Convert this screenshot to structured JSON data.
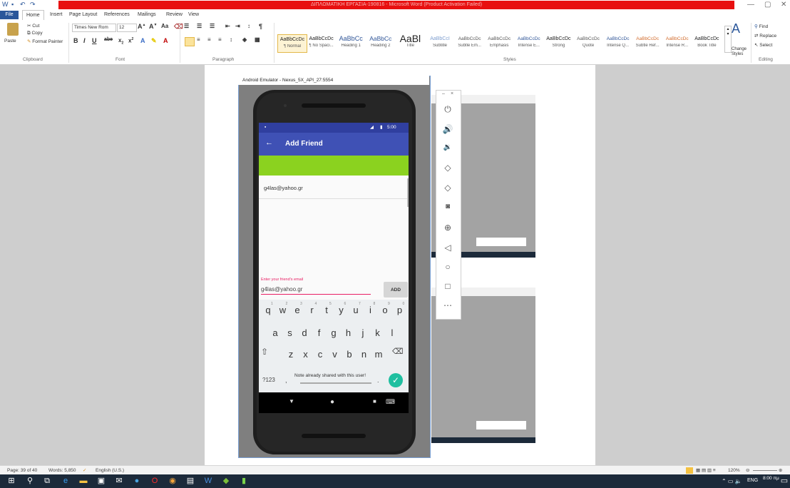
{
  "window": {
    "title": "ΔΙΠΛΩΜΑΤΙΚΗ ΕΡΓΑΣΙΑ-190816 - Microsoft Word (Product Activation Failed)",
    "minimize": "—",
    "restore": "▢",
    "close": "✕"
  },
  "qat": {
    "icons": [
      "word-icon",
      "save-icon",
      "undo-icon",
      "redo-icon"
    ]
  },
  "tabs": [
    "File",
    "Home",
    "Insert",
    "Page Layout",
    "References",
    "Mailings",
    "Review",
    "View"
  ],
  "ribbon": {
    "clipboard": {
      "paste": "Paste",
      "cut": "Cut",
      "copy": "Copy",
      "format_painter": "Format Painter",
      "label": "Clipboard"
    },
    "font": {
      "name": "Times New Rom",
      "size": "12",
      "label": "Font"
    },
    "paragraph": {
      "label": "Paragraph"
    },
    "styles": {
      "label": "Styles",
      "items": [
        {
          "sample": "AaBbCcDc",
          "name": "¶ Normal"
        },
        {
          "sample": "AaBbCcDc",
          "name": "¶ No Spaci..."
        },
        {
          "sample": "AaBbCc",
          "name": "Heading 1"
        },
        {
          "sample": "AaBbCc",
          "name": "Heading 2"
        },
        {
          "sample": "AaBl",
          "name": "Title"
        },
        {
          "sample": "AaBbCcI",
          "name": "Subtitle"
        },
        {
          "sample": "AaBbCcDc",
          "name": "Subtle Em..."
        },
        {
          "sample": "AaBbCcDc",
          "name": "Emphasis"
        },
        {
          "sample": "AaBbCcDc",
          "name": "Intense E..."
        },
        {
          "sample": "AaBbCcDc",
          "name": "Strong"
        },
        {
          "sample": "AaBbCcDc",
          "name": "Quote"
        },
        {
          "sample": "AaBbCcDc",
          "name": "Intense Q..."
        },
        {
          "sample": "AaBbCcDc",
          "name": "Subtle Ref..."
        },
        {
          "sample": "AaBbCcDc",
          "name": "Intense R..."
        },
        {
          "sample": "AaBbCcDc",
          "name": "Book Title"
        }
      ],
      "change_styles": "Change Styles"
    },
    "editing": {
      "find": "Find",
      "replace": "Replace",
      "select": "Select",
      "label": "Editing"
    }
  },
  "emulator": {
    "title": "Android Emulator - Nexus_5X_API_27:5554",
    "status_time": "5:00",
    "app_title": "Add Friend",
    "list_item": "g4las@yahoo.gr",
    "input_label": "Enter your friend's email",
    "input_value": "g4las@yahoo.gr",
    "add_button": "ADD",
    "keyboard_rows": [
      [
        "q",
        "w",
        "e",
        "r",
        "t",
        "y",
        "u",
        "i",
        "o",
        "p"
      ],
      [
        "a",
        "s",
        "d",
        "f",
        "g",
        "h",
        "j",
        "k",
        "l"
      ],
      [
        "z",
        "x",
        "c",
        "v",
        "b",
        "n",
        "m"
      ]
    ],
    "number_hints": [
      "1",
      "2",
      "3",
      "4",
      "5",
      "6",
      "7",
      "8",
      "9",
      "0"
    ],
    "symbols_key": "?123",
    "comma_key": ",",
    "period_key": ".",
    "toast": "Note already shared with this user!"
  },
  "statusbar": {
    "page": "Page: 39 of 40",
    "words": "Words: 5,850",
    "language": "English (U.S.)",
    "zoom": "120%"
  },
  "taskbar": {
    "time": "8:00 πμ",
    "lang": "ENG"
  },
  "colors": {
    "app_bar": "#3f51b5",
    "status_bar": "#303f9f",
    "accent_green": "#8bd21f",
    "pink_accent": "#e91e63",
    "title_red": "#e81010"
  }
}
